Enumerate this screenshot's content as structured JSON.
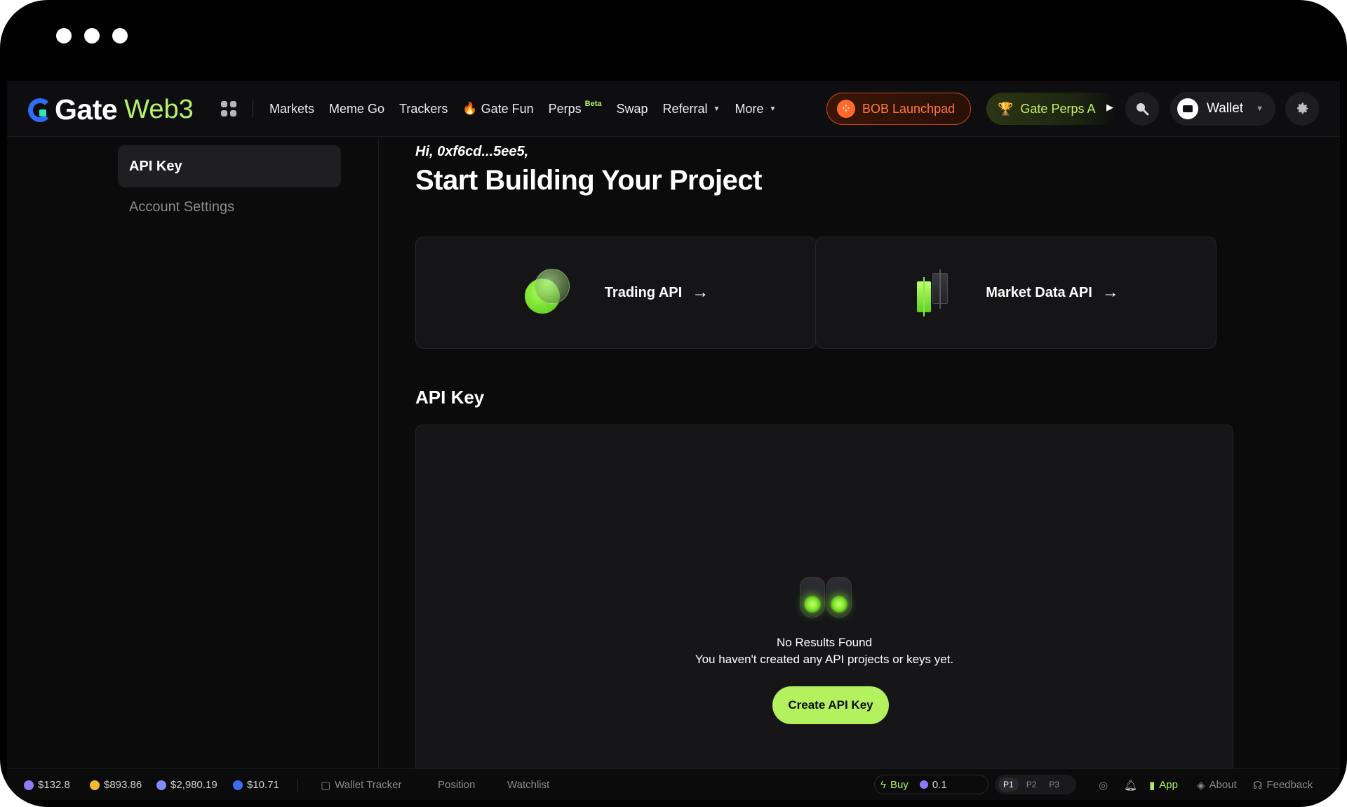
{
  "window": {
    "controls": [
      "dot",
      "dot",
      "dot"
    ]
  },
  "nav": {
    "logo_gate": "Gate",
    "logo_web3": "Web3",
    "links": [
      {
        "label": "Markets"
      },
      {
        "label": "Meme Go"
      },
      {
        "label": "Trackers"
      },
      {
        "label": "Gate Fun"
      },
      {
        "label": "Perps",
        "badge": "Beta"
      },
      {
        "label": "Swap"
      },
      {
        "label": "Referral"
      },
      {
        "label": "More"
      }
    ],
    "bob_label": "BOB Launchpad",
    "perps_label": "Gate Perps A",
    "wallet_label": "Wallet"
  },
  "sidebar": {
    "items": [
      {
        "label": "API Key",
        "active": true
      },
      {
        "label": "Account Settings",
        "active": false
      }
    ]
  },
  "main": {
    "greeting": "Hi, 0xf6cd...5ee5,",
    "title": "Start Building Your Project",
    "cards": [
      {
        "label": "Trading API",
        "icon": "coins-icon"
      },
      {
        "label": "Market Data API",
        "icon": "candlestick-icon"
      }
    ],
    "section_title": "API Key",
    "empty": {
      "title": "No Results Found",
      "subtitle": "You haven't created any API projects or keys yet.",
      "button": "Create API Key"
    }
  },
  "footer": {
    "prices": [
      {
        "value": "$132.8",
        "color": "#8b7cf6"
      },
      {
        "value": "$893.86",
        "color": "#f3ba2f"
      },
      {
        "value": "$2,980.19",
        "color": "#7b8ff7"
      },
      {
        "value": "$10.71",
        "color": "#3a6df0"
      }
    ],
    "tabs": [
      "Wallet Tracker",
      "Position",
      "Watchlist"
    ],
    "buy_label": "Buy",
    "buy_amount": "0.1",
    "presets": [
      "P1",
      "P2",
      "P3"
    ],
    "app_label": "App",
    "about_label": "About",
    "feedback_label": "Feedback"
  },
  "colors": {
    "accent": "#b3f25e",
    "background": "#0b0b0c",
    "bob": "#ff6a2a"
  }
}
